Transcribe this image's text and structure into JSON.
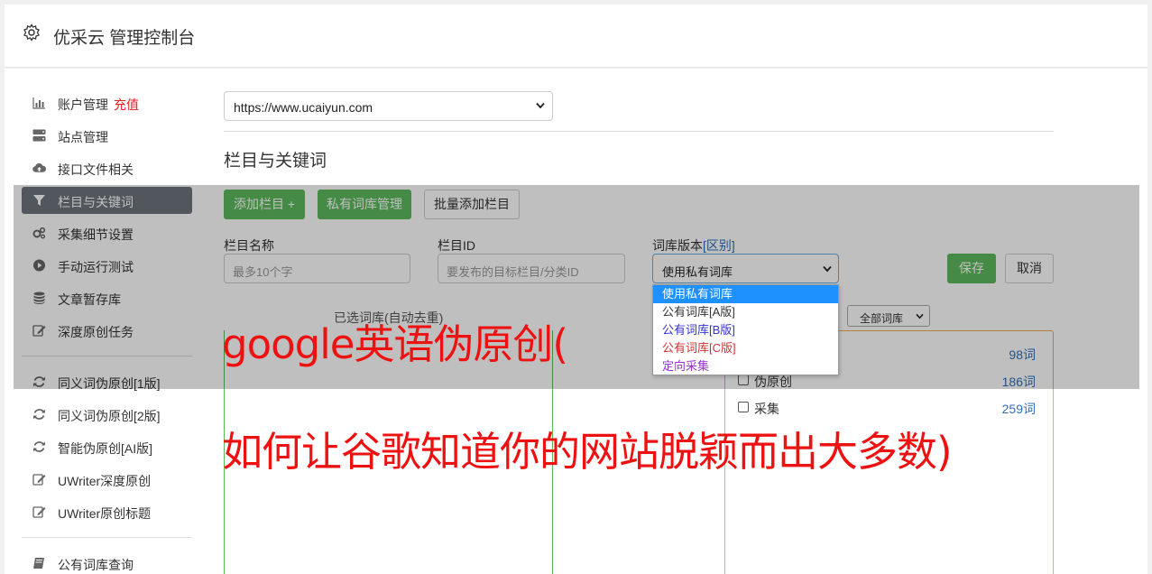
{
  "header": {
    "title": "优采云 管理控制台",
    "icon": "gear-icon"
  },
  "sidebar": {
    "items": [
      {
        "label": "账户管理",
        "badge": "充值",
        "icon": "bar-chart-icon"
      },
      {
        "label": "站点管理",
        "icon": "server-icon"
      },
      {
        "label": "接口文件相关",
        "icon": "cloud-upload-icon"
      },
      {
        "label": "栏目与关键词",
        "icon": "filter-icon",
        "active": true
      },
      {
        "label": "采集细节设置",
        "icon": "gears-icon"
      },
      {
        "label": "手动运行测试",
        "icon": "play-circle-icon"
      },
      {
        "label": "文章暂存库",
        "icon": "database-icon"
      },
      {
        "label": "深度原创任务",
        "icon": "edit-icon"
      },
      {
        "label": "同义词伪原创[1版]",
        "icon": "refresh-icon"
      },
      {
        "label": "同义词伪原创[2版]",
        "icon": "refresh-icon"
      },
      {
        "label": "智能伪原创[AI版]",
        "icon": "refresh-icon"
      },
      {
        "label": "UWriter深度原创",
        "icon": "edit-icon"
      },
      {
        "label": "UWriter原创标题",
        "icon": "edit-icon"
      },
      {
        "label": "公有词库查询",
        "icon": "book-icon"
      }
    ]
  },
  "site_select": {
    "value": "https://www.ucaiyun.com"
  },
  "section_title": "栏目与关键词",
  "toolbar": {
    "add_column": "添加栏目 +",
    "private_dict": "私有词库管理",
    "batch_add": "批量添加栏目"
  },
  "form": {
    "name_label": "栏目名称",
    "name_placeholder": "最多10个字",
    "id_label": "栏目ID",
    "id_placeholder": "要发布的目标栏目/分类ID",
    "dict_label": "词库版本",
    "dict_label_link": "[区别]",
    "dict_value": "使用私有词库",
    "save": "保存",
    "cancel": "取消"
  },
  "dropdown": {
    "options": [
      {
        "label": "使用私有词库",
        "color": "#ffffff",
        "selected": true
      },
      {
        "label": "公有词库[A版]",
        "color": "#333333"
      },
      {
        "label": "公有词库[B版]",
        "color": "#3333cc"
      },
      {
        "label": "公有词库[C版]",
        "color": "#cc3333"
      },
      {
        "label": "定向采集",
        "color": "#9933cc"
      }
    ]
  },
  "selected_box": {
    "caption": "已选词库(自动去重)"
  },
  "library": {
    "filter": "全部词库",
    "rows": [
      {
        "name": "",
        "count": "98词"
      },
      {
        "name": "伪原创",
        "count": "186词"
      },
      {
        "name": "采集",
        "count": "259词"
      }
    ]
  },
  "watermark": {
    "line1": "google英语伪原创(",
    "line2": "如何让谷歌知道你的网站脱颖而出大多数)"
  },
  "colors": {
    "primary_green": "#5cb85c",
    "overlay_text_red": "#ee1111",
    "link_blue": "#2f6fb8",
    "active_gray": "#6c757d"
  }
}
